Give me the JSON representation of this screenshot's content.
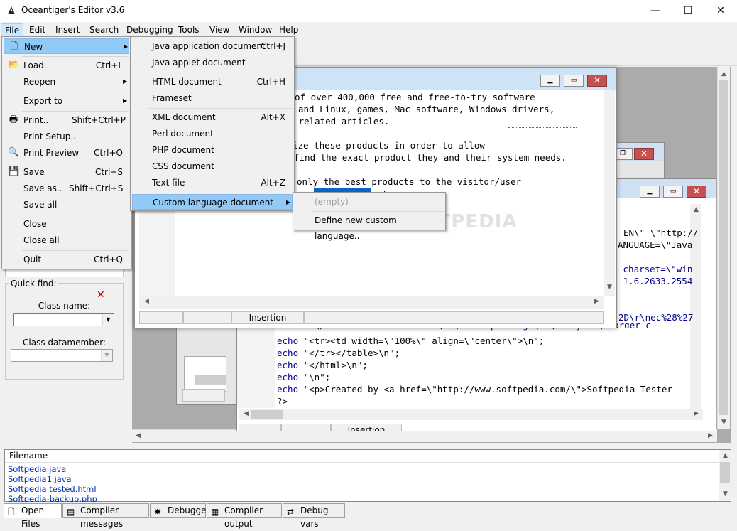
{
  "window": {
    "title": "Oceantiger's Editor v3.6",
    "controls": [
      "—",
      "☐",
      "✕"
    ]
  },
  "menubar": [
    "File",
    "Edit",
    "Insert",
    "Search",
    "Debugging",
    "Tools",
    "View",
    "Window",
    "Help"
  ],
  "file_menu": [
    {
      "label": "New",
      "shortcut": "",
      "submenu": true
    },
    {
      "label": "Load..",
      "shortcut": "Ctrl+L"
    },
    {
      "label": "Reopen",
      "shortcut": "",
      "submenu": true
    },
    {
      "label": "Export to",
      "shortcut": "",
      "submenu": true
    },
    {
      "label": "Print..",
      "shortcut": "Shift+Ctrl+P"
    },
    {
      "label": "Print Setup..",
      "shortcut": ""
    },
    {
      "label": "Print Preview",
      "shortcut": "Ctrl+O"
    },
    {
      "label": "Save",
      "shortcut": "Ctrl+S"
    },
    {
      "label": "Save as..",
      "shortcut": "Shift+Ctrl+S"
    },
    {
      "label": "Save all",
      "shortcut": ""
    },
    {
      "label": "Close",
      "shortcut": ""
    },
    {
      "label": "Close all",
      "shortcut": ""
    },
    {
      "label": "Quit",
      "shortcut": "Ctrl+Q"
    }
  ],
  "new_submenu": [
    {
      "label": "Java application document",
      "shortcut": "Ctrl+J"
    },
    {
      "label": "Java applet document",
      "shortcut": ""
    },
    {
      "label": "HTML document",
      "shortcut": "Ctrl+H"
    },
    {
      "label": "Frameset",
      "shortcut": ""
    },
    {
      "label": "XML document",
      "shortcut": "Alt+X"
    },
    {
      "label": "Perl document",
      "shortcut": ""
    },
    {
      "label": "PHP document",
      "shortcut": ""
    },
    {
      "label": "CSS document",
      "shortcut": ""
    },
    {
      "label": "Text file",
      "shortcut": "Alt+Z"
    },
    {
      "label": "Custom language document",
      "shortcut": ""
    }
  ],
  "custom_submenu": [
    {
      "label": "(empty)"
    },
    {
      "label": "Define new custom language.."
    }
  ],
  "quick_find": {
    "title": "Quick find:",
    "class_name_label": "Class name:",
    "class_datamember_label": "Class datamember:"
  },
  "front_editor": {
    "lines": [
      "y of over 400,000 free and free-to-try software",
      "and Linux, games, Mac software, Windows drivers,",
      "-related articles.",
      "",
      "ize these products in order to allow",
      "find the exact product they and their system needs.",
      "",
      "only the best products to the visitor/user",
      "              notes."
    ],
    "status": [
      "",
      "",
      "Insertion",
      ""
    ]
  },
  "back_editor": {
    "lines_top": [
      "EN\\\" \\\"http://",
      "ANGUAGE=\\\"Java",
      "",
      " charset=\\\"win",
      " 1.6.2633.2554"
    ],
    "line_mid": "2D\\r\\nec%28%27",
    "line_partial": "echo \"<\\/center><table border=\\\"1\\\" cellpadding=\\\"2\\\" style=\\\"border-c",
    "lines_code": [
      {
        "kw": "echo",
        "rest": " \"<tr><td width=\\\"100%\\\" align=\\\"center\\\">\\n\";"
      },
      {
        "kw": "echo",
        "rest": " \"</tr></table>\\n\";"
      },
      {
        "kw": "echo",
        "rest": " \"</html>\\n\";"
      },
      {
        "kw": "echo",
        "rest": " \"\\n\";"
      },
      {
        "kw": "echo",
        "rest": " \"<p>Created by <a href=\\\"http://www.softpedia.com/\\\">Softpedia Tester"
      },
      {
        "kw": "",
        "rest": "?>"
      }
    ],
    "status_partial": "Insertion"
  },
  "files": {
    "header": "Filename",
    "items": [
      "Softpedia.java",
      "Softpedia1.java",
      "Softpedia tested.html",
      "Softpedia-backup.php"
    ]
  },
  "tabs": [
    "Open Files",
    "Compiler messages",
    "Debugger",
    "Compiler output",
    "Debug vars"
  ],
  "watermark": "SOFTPEDIA"
}
